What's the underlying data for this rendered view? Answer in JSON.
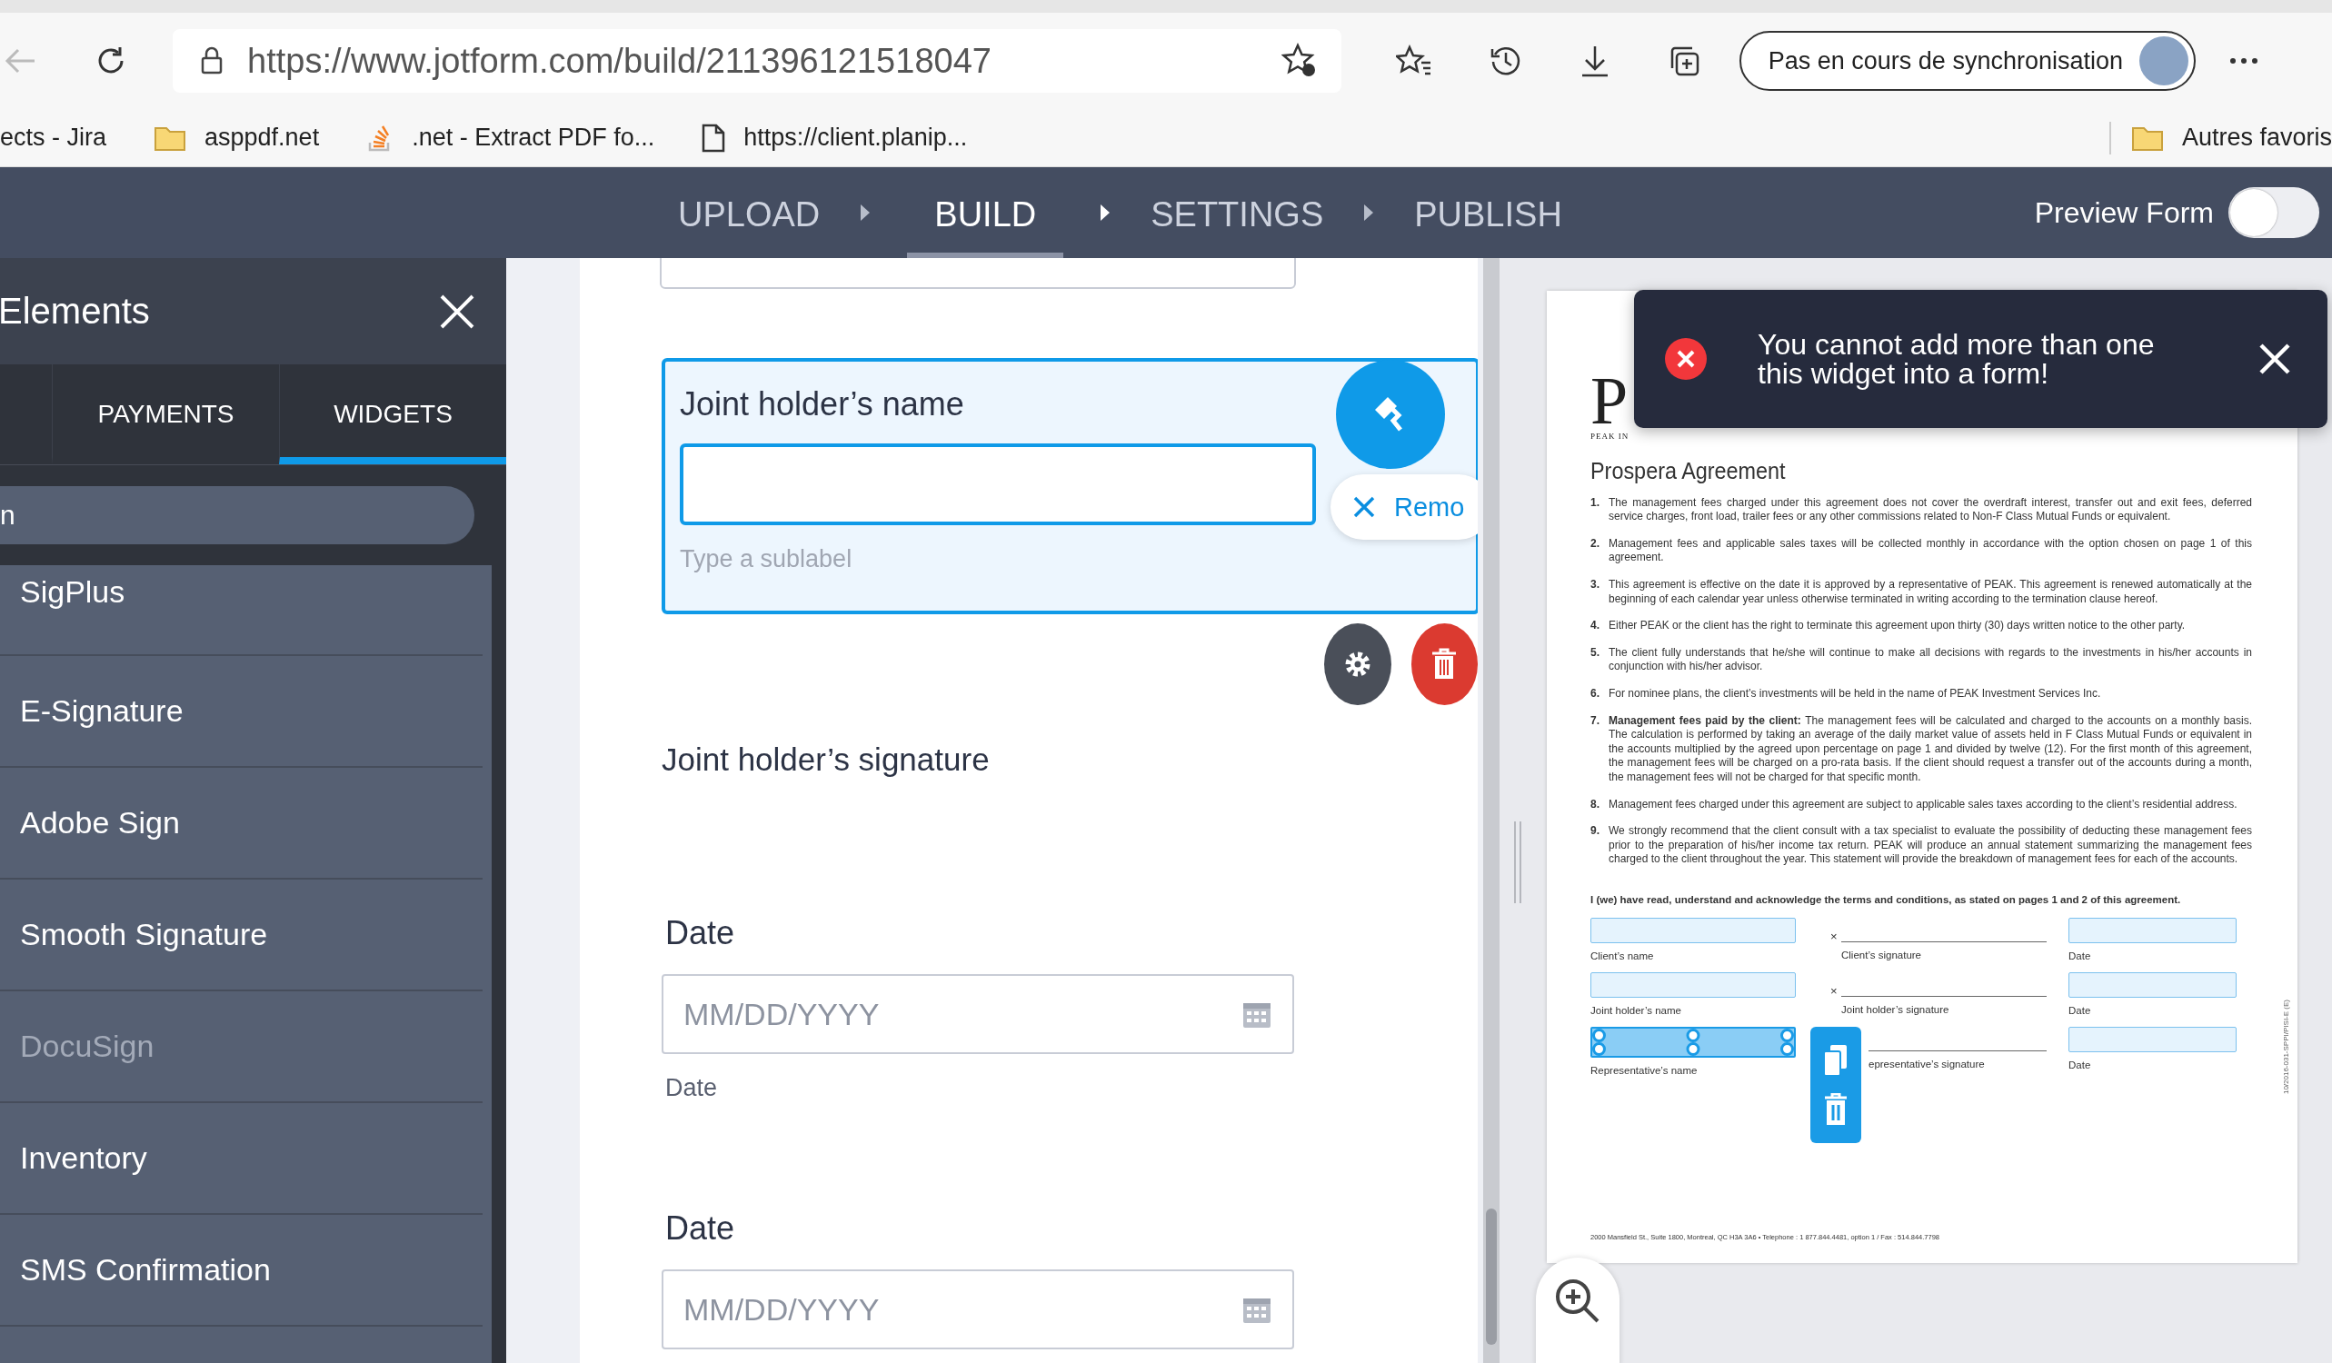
{
  "browser": {
    "url": "https://www.jotform.com/build/211396121518047",
    "sync_button": "Pas en cours de synchronisation",
    "bookmarks": [
      {
        "kind": "plain",
        "label": "ects - Jira"
      },
      {
        "kind": "folder",
        "label": "asppdf.net"
      },
      {
        "kind": "stack",
        "label": ".net - Extract PDF fo..."
      },
      {
        "kind": "page",
        "label": "https://client.planip..."
      }
    ],
    "other_bookmarks": "Autres favoris"
  },
  "builder": {
    "steps": [
      {
        "label": "UPLOAD",
        "selected": false
      },
      {
        "label": "BUILD",
        "selected": true
      },
      {
        "label": "SETTINGS",
        "selected": false
      },
      {
        "label": "PUBLISH",
        "selected": false
      }
    ],
    "preview_form": {
      "label": "Preview Form",
      "on": false
    }
  },
  "elements_panel": {
    "title": "Elements",
    "tabs": [
      {
        "label": "PAYMENTS",
        "selected": false
      },
      {
        "label": "WIDGETS",
        "selected": true
      }
    ],
    "search": {
      "value": "n"
    },
    "items": [
      {
        "label": "SigPlus",
        "disabled": false
      },
      {
        "label": "E-Signature",
        "disabled": false
      },
      {
        "label": "Adobe Sign",
        "disabled": false
      },
      {
        "label": "Smooth Signature",
        "disabled": false
      },
      {
        "label": "DocuSign",
        "disabled": true
      },
      {
        "label": "Inventory",
        "disabled": false
      },
      {
        "label": "SMS Confirmation",
        "disabled": false
      }
    ]
  },
  "form": {
    "fields": [
      {
        "kind": "stub"
      },
      {
        "kind": "text",
        "label": "Joint holder’s name",
        "selected": true,
        "sublabel_placeholder": "Type a sublabel",
        "remove_label": "Remo"
      },
      {
        "kind": "signature",
        "label": "Joint holder’s signature"
      },
      {
        "kind": "date",
        "label": "Date",
        "placeholder": "MM/DD/YYYY",
        "sublabel": "Date"
      },
      {
        "kind": "date",
        "label": "Date",
        "placeholder": "MM/DD/YYYY"
      }
    ]
  },
  "toast": {
    "message": "You cannot add more than one this widget into a form!"
  },
  "document": {
    "logo_letter": "P",
    "logo_caption": "PEAK IN",
    "title": "Prospera Agreement",
    "clauses": [
      {
        "number": "1.",
        "text": "The management fees charged under this agreement does not cover the overdraft interest, transfer out and exit fees, deferred service charges, front load, trailer fees or any other commissions related to Non-F Class Mutual Funds or equivalent."
      },
      {
        "number": "2.",
        "text": "Management fees and applicable sales taxes will be collected monthly in accordance with the option chosen on page 1 of this agreement."
      },
      {
        "number": "3.",
        "text": "This agreement is effective on the date it is approved by a representative of PEAK. This agreement is renewed automatically at the beginning of each calendar year unless otherwise terminated in writing according to the termination clause hereof."
      },
      {
        "number": "4.",
        "text": "Either PEAK or the client has the right to terminate this agreement upon thirty (30) days written notice to the other party."
      },
      {
        "number": "5.",
        "text": "The client fully understands that he/she will continue to make all decisions with regards to the investments in his/her accounts in conjunction with his/her advisor."
      },
      {
        "number": "6.",
        "text": "For nominee plans, the client’s investments will be held in the name of PEAK Investment Services Inc."
      },
      {
        "number": "7.",
        "text": "**Management fees paid by the client:** The management fees will be calculated and charged to the accounts on a monthly basis. The calculation is performed by taking an average of the daily market value of assets held in F Class Mutual Funds or equivalent in the accounts multiplied by the agreed upon percentage on page 1 and divided by twelve (12). For the first month of this agreement, the management fees will be charged on a pro-rata basis. If the client should request a transfer out of the accounts during a month, the management fees will not be charged for that specific month."
      },
      {
        "number": "8.",
        "text": "Management fees charged under this agreement are subject to applicable sales taxes according to the client’s residential address."
      },
      {
        "number": "9.",
        "text": "We strongly recommend that the client consult with a tax specialist to evaluate the possibility of deducting these management fees prior to the preparation of his/her income tax return. PEAK will produce an annual statement summarizing the management fees charged to the client throughout the year. This statement will provide the breakdown of management fees for each of the accounts."
      }
    ],
    "acknowledgment": "I (we) have read, understand and acknowledge the terms and conditions, as stated on pages 1 and 2 of this agreement.",
    "signature_rows": [
      {
        "name_label": "Client’s name",
        "name_selected": false,
        "signature_mark": "×",
        "signature_label": "Client’s signature",
        "date_label": "Date"
      },
      {
        "name_label": "Joint holder’s name",
        "name_selected": false,
        "signature_mark": "×",
        "signature_label": "Joint holder’s signature",
        "date_label": "Date"
      },
      {
        "name_label": "Representative’s name",
        "name_selected": true,
        "signature_label": "epresentative’s signature",
        "date_label": "Date"
      }
    ],
    "footer": "2000 Mansfield St., Suite 1800, Montreal, QC  H3A 3A6  •  Telephone : 1 877.844.4481, option 1 / Fax : 514.844.7798",
    "side_code": "10/2016-031-SPPI/PISI-E (E)"
  }
}
